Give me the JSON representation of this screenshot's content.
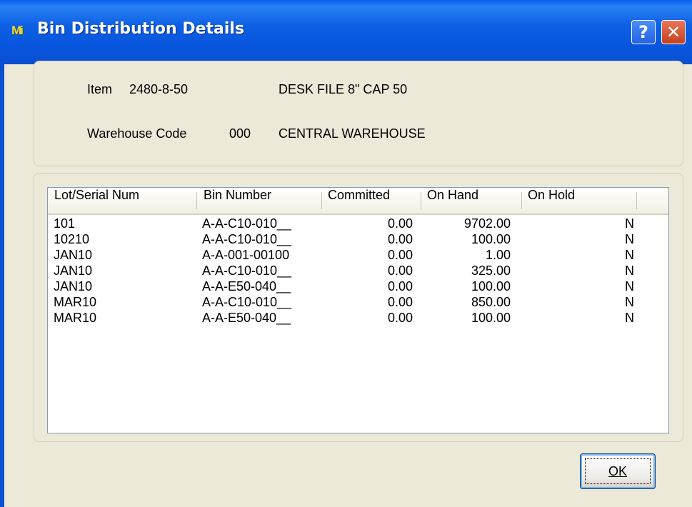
{
  "window": {
    "title": "Bin Distribution Details",
    "app_icon_text": "Mi",
    "help_label": "?",
    "close_label": "✕"
  },
  "info": {
    "item_label": "Item",
    "item_value": "2480-8-50",
    "item_description": "DESK FILE 8\" CAP 50",
    "warehouse_label": "Warehouse Code",
    "warehouse_value": "000",
    "warehouse_description": "CENTRAL WAREHOUSE"
  },
  "table": {
    "columns": [
      "Lot/Serial Num",
      "Bin Number",
      "Committed",
      "On Hand",
      "On Hold"
    ],
    "rows": [
      {
        "lot": "101",
        "bin": "A-A-C10-010__",
        "committed": "0.00",
        "on_hand": "9702.00",
        "on_hold": "N"
      },
      {
        "lot": "10210",
        "bin": "A-A-C10-010__",
        "committed": "0.00",
        "on_hand": "100.00",
        "on_hold": "N"
      },
      {
        "lot": "JAN10",
        "bin": "A-A-001-00100",
        "committed": "0.00",
        "on_hand": "1.00",
        "on_hold": "N"
      },
      {
        "lot": "JAN10",
        "bin": "A-A-C10-010__",
        "committed": "0.00",
        "on_hand": "325.00",
        "on_hold": "N"
      },
      {
        "lot": "JAN10",
        "bin": "A-A-E50-040__",
        "committed": "0.00",
        "on_hand": "100.00",
        "on_hold": "N"
      },
      {
        "lot": "MAR10",
        "bin": "A-A-C10-010__",
        "committed": "0.00",
        "on_hand": "850.00",
        "on_hold": "N"
      },
      {
        "lot": "MAR10",
        "bin": "A-A-E50-040__",
        "committed": "0.00",
        "on_hand": "100.00",
        "on_hold": "N"
      }
    ]
  },
  "buttons": {
    "ok_label": "OK"
  }
}
